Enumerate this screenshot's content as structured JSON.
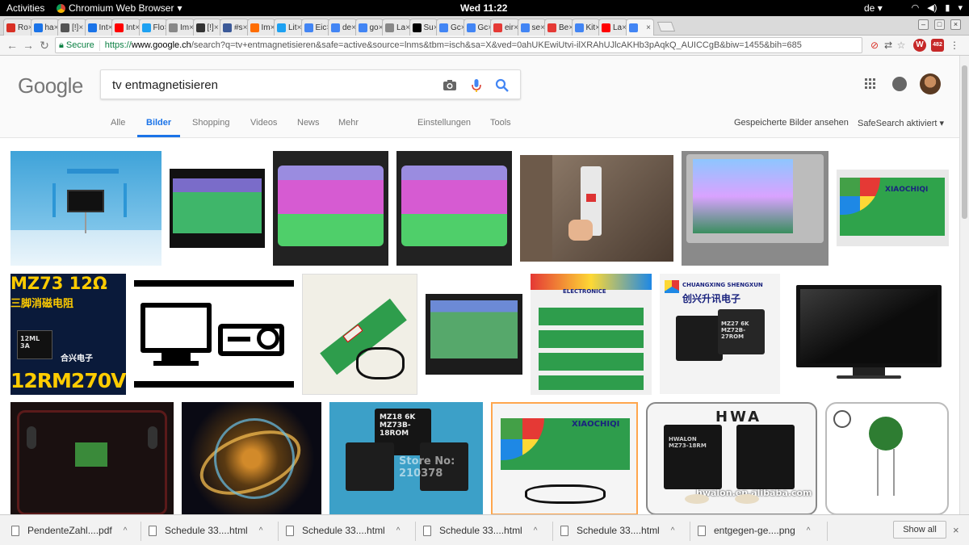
{
  "topbar": {
    "activities": "Activities",
    "app_name": "Chromium Web Browser",
    "clock": "Wed 11:22",
    "lang": "de"
  },
  "tabs": [
    {
      "label": "Ro",
      "color": "#d93025"
    },
    {
      "label": "ha",
      "color": "#1a73e8"
    },
    {
      "label": "[!]",
      "color": "#555555"
    },
    {
      "label": "Int",
      "color": "#1a73e8"
    },
    {
      "label": "Int",
      "color": "#ff0000"
    },
    {
      "label": "Flo",
      "color": "#1da1f2"
    },
    {
      "label": "Im",
      "color": "#888888"
    },
    {
      "label": "[!]",
      "color": "#333333"
    },
    {
      "label": "#s",
      "color": "#3b5998"
    },
    {
      "label": "Im",
      "color": "#ff6d00"
    },
    {
      "label": "Lit",
      "color": "#1da1f2"
    },
    {
      "label": "Eic",
      "color": "#4285f4"
    },
    {
      "label": "de",
      "color": "#4285f4"
    },
    {
      "label": "go",
      "color": "#4285f4"
    },
    {
      "label": "La",
      "color": "#888888"
    },
    {
      "label": "Su",
      "color": "#000000"
    },
    {
      "label": "Gc",
      "color": "#4285f4"
    },
    {
      "label": "Gc",
      "color": "#4285f4"
    },
    {
      "label": "eir",
      "color": "#e53935"
    },
    {
      "label": "se",
      "color": "#4285f4"
    },
    {
      "label": "Be",
      "color": "#e53935"
    },
    {
      "label": "Kit",
      "color": "#4285f4"
    },
    {
      "label": "La",
      "color": "#ff0000"
    },
    {
      "label": "",
      "color": "#4285f4"
    }
  ],
  "address": {
    "secure_label": "Secure",
    "url_scheme": "https://",
    "url_host": "www.google.ch",
    "url_rest": "/search?q=tv+entmagnetisieren&safe=active&source=lnms&tbm=isch&sa=X&ved=0ahUKEwiUtvi-ilXRAhUJlcAKHb3pAqkQ_AUICCgB&biw=1455&bih=685",
    "badge_count": "482"
  },
  "google": {
    "logo": "Google",
    "query": "tv entmagnetisieren",
    "tabs": [
      "Alle",
      "Bilder",
      "Shopping",
      "Videos",
      "News",
      "Mehr",
      "Einstellungen",
      "Tools"
    ],
    "saved_images": "Gespeicherte Bilder ansehen",
    "safesearch": "SafeSearch aktiviert"
  },
  "thumb_text": {
    "mz73_top": "MZ73  12Ω",
    "mz73_cn": "三脚消磁电阻",
    "mz73_chip": "12ML 3A",
    "mz73_shop": "合兴电子",
    "mz73_bottom": "12RM270V",
    "xiaochiqi": "XIAOCHIQI",
    "xiaochiqi2": "XIAOCHIQI",
    "electronics": "ELECTRONICE",
    "shengxun": "CHUANGXING SHENGXUN",
    "shengxun_cn": "创兴升讯电子",
    "mz27": "MZ27 6K MZ72B-27ROM",
    "mz18": "MZ18 6K MZ73B-18ROM",
    "store": "Store No: 210378",
    "hwa": "HWA",
    "hwalon": "hwalon.en.alibaba.com",
    "hwalon_chip": "HWALON MZ73-18RM"
  },
  "downloads": [
    {
      "name": "PendenteZahl....pdf"
    },
    {
      "name": "Schedule 33....html"
    },
    {
      "name": "Schedule 33....html"
    },
    {
      "name": "Schedule 33....html"
    },
    {
      "name": "Schedule 33....html"
    },
    {
      "name": "entgegen-ge....png"
    }
  ],
  "show_all": "Show all"
}
